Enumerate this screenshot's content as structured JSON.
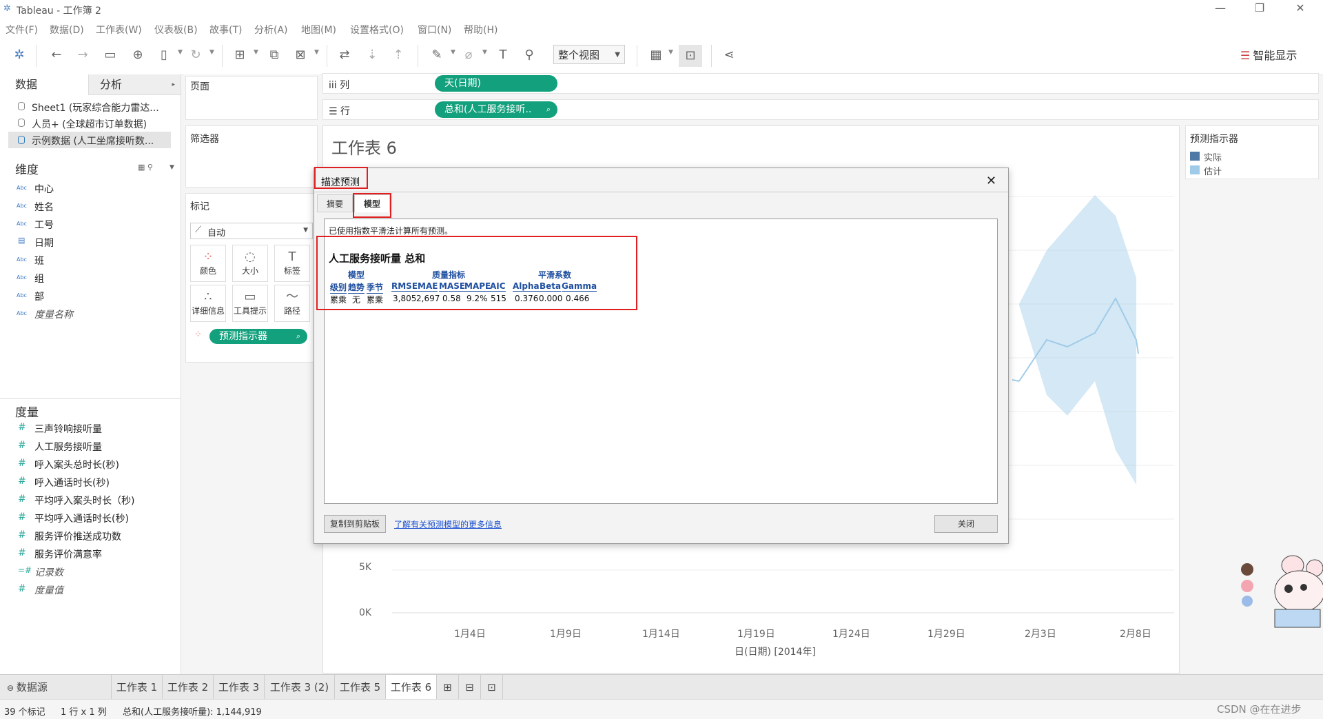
{
  "window": {
    "title": "Tableau - 工作簿 2",
    "controls": [
      "—",
      "❐",
      "✕"
    ]
  },
  "menu": [
    "文件(F)",
    "数据(D)",
    "工作表(W)",
    "仪表板(B)",
    "故事(T)",
    "分析(A)",
    "地图(M)",
    "设置格式(O)",
    "窗口(N)",
    "帮助(H)"
  ],
  "toolbar": {
    "fit_view": "整个视图",
    "show_me": "智能显示"
  },
  "left_pane": {
    "tabs": [
      "数据",
      "分析"
    ],
    "datasources": [
      "Sheet1 (玩家综合能力雷达...",
      "人员+ (全球超市订单数据)",
      "示例数据 (人工坐席接听数..."
    ],
    "dimensions_title": "维度",
    "dimensions": [
      {
        "type": "Abc",
        "name": "中心"
      },
      {
        "type": "Abc",
        "name": "姓名"
      },
      {
        "type": "Abc",
        "name": "工号"
      },
      {
        "type": "date",
        "name": "日期"
      },
      {
        "type": "Abc",
        "name": "班"
      },
      {
        "type": "Abc",
        "name": "组"
      },
      {
        "type": "Abc",
        "name": "部"
      },
      {
        "type": "Abc",
        "name": "度量名称"
      }
    ],
    "measures_title": "度量",
    "measures": [
      "三声铃响接听量",
      "人工服务接听量",
      "呼入案头总时长(秒)",
      "呼入通话时长(秒)",
      "平均呼入案头时长（秒)",
      "平均呼入通话时长(秒)",
      "服务评价推送成功数",
      "服务评价满意率",
      "记录数",
      "度量值"
    ]
  },
  "shelves": {
    "pages": "页面",
    "filters": "筛选器",
    "marks": "标记",
    "mark_type": "自动",
    "mark_buttons": [
      "颜色",
      "大小",
      "标签",
      "详细信息",
      "工具提示",
      "路径"
    ],
    "mark_pill": "预测指示器",
    "columns_label": "列",
    "rows_label": "行",
    "columns_pill": "天(日期)",
    "rows_pill": "总和(人工服务接听.."
  },
  "view": {
    "sheet_title": "工作表 6",
    "y_ticks": [
      "5K",
      "0K"
    ],
    "x_ticks": [
      "1月4日",
      "1月9日",
      "1月14日",
      "1月19日",
      "1月24日",
      "1月29日",
      "2月3日",
      "2月8日"
    ],
    "x_title": "日(日期) [2014年]"
  },
  "chart_data": {
    "type": "line",
    "x": [
      "2014-01-04",
      "2014-01-09",
      "2014-01-14",
      "2014-01-19",
      "2014-01-24",
      "2014-01-29",
      "2014-02-03",
      "2014-02-08"
    ],
    "xlabel": "日(日期) [2014年]",
    "legend_title": "预测指示器",
    "series": [
      {
        "name": "实际",
        "color": "#4e79a7"
      },
      {
        "name": "估计",
        "color": "#a0cbe8"
      }
    ],
    "visible_ytick_labels": [
      "0K",
      "5K"
    ]
  },
  "legend": {
    "title": "预测指示器",
    "items": [
      {
        "label": "实际",
        "color": "#4e79a7"
      },
      {
        "label": "估计",
        "color": "#a0cbe8"
      }
    ]
  },
  "sheet_tabs": [
    "数据源",
    "工作表 1",
    "工作表 2",
    "工作表 3",
    "工作表 3 (2)",
    "工作表 5",
    "工作表 6"
  ],
  "status": {
    "marks": "39 个标记",
    "dims": "1 行 x 1 列",
    "sum": "总和(人工服务接听量): 1,144,919"
  },
  "watermark": "CSDN @在在进步",
  "dialog": {
    "title": "描述预测",
    "tabs": [
      "摘要",
      "模型"
    ],
    "intro": "已使用指数平滑法计算所有预测。",
    "measure_title": "人工服务接听量 总和",
    "groups": [
      "模型",
      "质量指标",
      "平滑系数"
    ],
    "headers": [
      "级别",
      "趋势",
      "季节",
      "RMSE",
      "MAE",
      "MASE",
      "MAPE",
      "AIC",
      "Alpha",
      "Beta",
      "Gamma"
    ],
    "values": [
      "累乘",
      "无",
      "累乘",
      "3,805",
      "2,697",
      "0.58",
      "9.2%",
      "515",
      "0.376",
      "0.000",
      "0.466"
    ],
    "copy_button": "复制到剪贴板",
    "more_link": "了解有关预测模型的更多信息",
    "close_button": "关闭"
  }
}
